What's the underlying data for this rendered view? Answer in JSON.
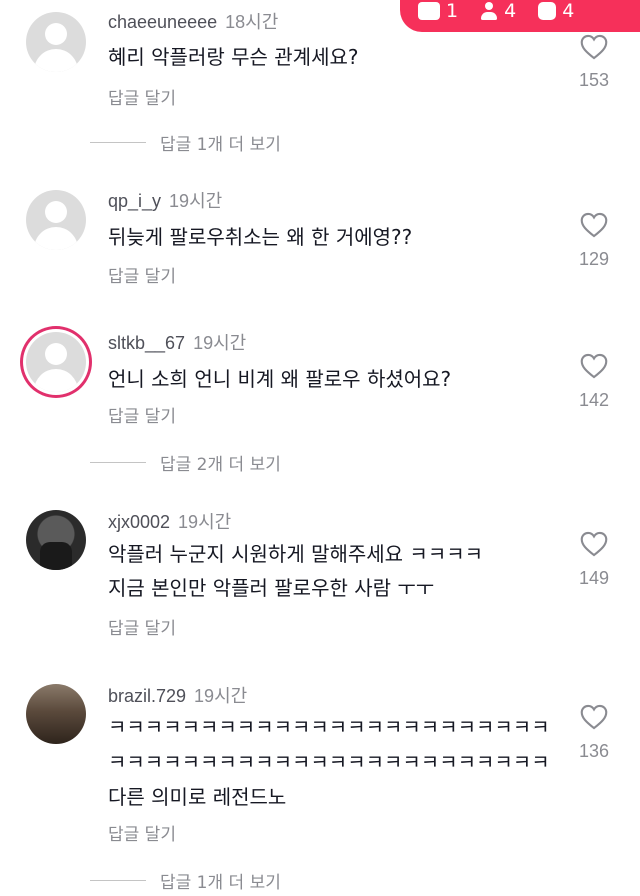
{
  "badge": {
    "comments": "1",
    "people": "4",
    "shares": "4"
  },
  "comments": [
    {
      "username": "chaeeuneeee",
      "time": "18시간",
      "text": [
        "혜리 악플러랑 무슨 관계세요?"
      ],
      "reply": "답글 달기",
      "likes": "153",
      "view_more": "답글 1개 더 보기"
    },
    {
      "username": "qp_i_y",
      "time": "19시간",
      "text": [
        "뒤늦게 팔로우취소는 왜 한 거에영??"
      ],
      "reply": "답글 달기",
      "likes": "129"
    },
    {
      "username": "sltkb__67",
      "time": "19시간",
      "text": [
        "언니 소희 언니 비계 왜 팔로우 하셨어요?"
      ],
      "reply": "답글 달기",
      "likes": "142",
      "view_more": "답글 2개 더 보기"
    },
    {
      "username": "xjx0002",
      "time": "19시간",
      "text": [
        "악플러 누군지 시원하게 말해주세요 ㅋㅋㅋㅋ",
        "지금 본인만 악플러 팔로우한 사람 ㅜㅜ"
      ],
      "reply": "답글 달기",
      "likes": "149"
    },
    {
      "username": "brazil.729",
      "time": "19시간",
      "text": [
        "ㅋㅋㅋㅋㅋㅋㅋㅋㅋㅋㅋㅋㅋㅋㅋㅋㅋㅋㅋㅋㅋㅋㅋㅋ",
        "ㅋㅋㅋㅋㅋㅋㅋㅋㅋㅋㅋㅋㅋㅋㅋㅋㅋㅋㅋㅋㅋㅋㅋㅋ",
        "다른 의미로 레전드노"
      ],
      "reply": "답글 달기",
      "likes": "136",
      "view_more": "답글 1개 더 보기"
    }
  ],
  "colors": {
    "accent": "#f6305a",
    "ring": "#e1306c",
    "muted": "#8a8b91"
  }
}
